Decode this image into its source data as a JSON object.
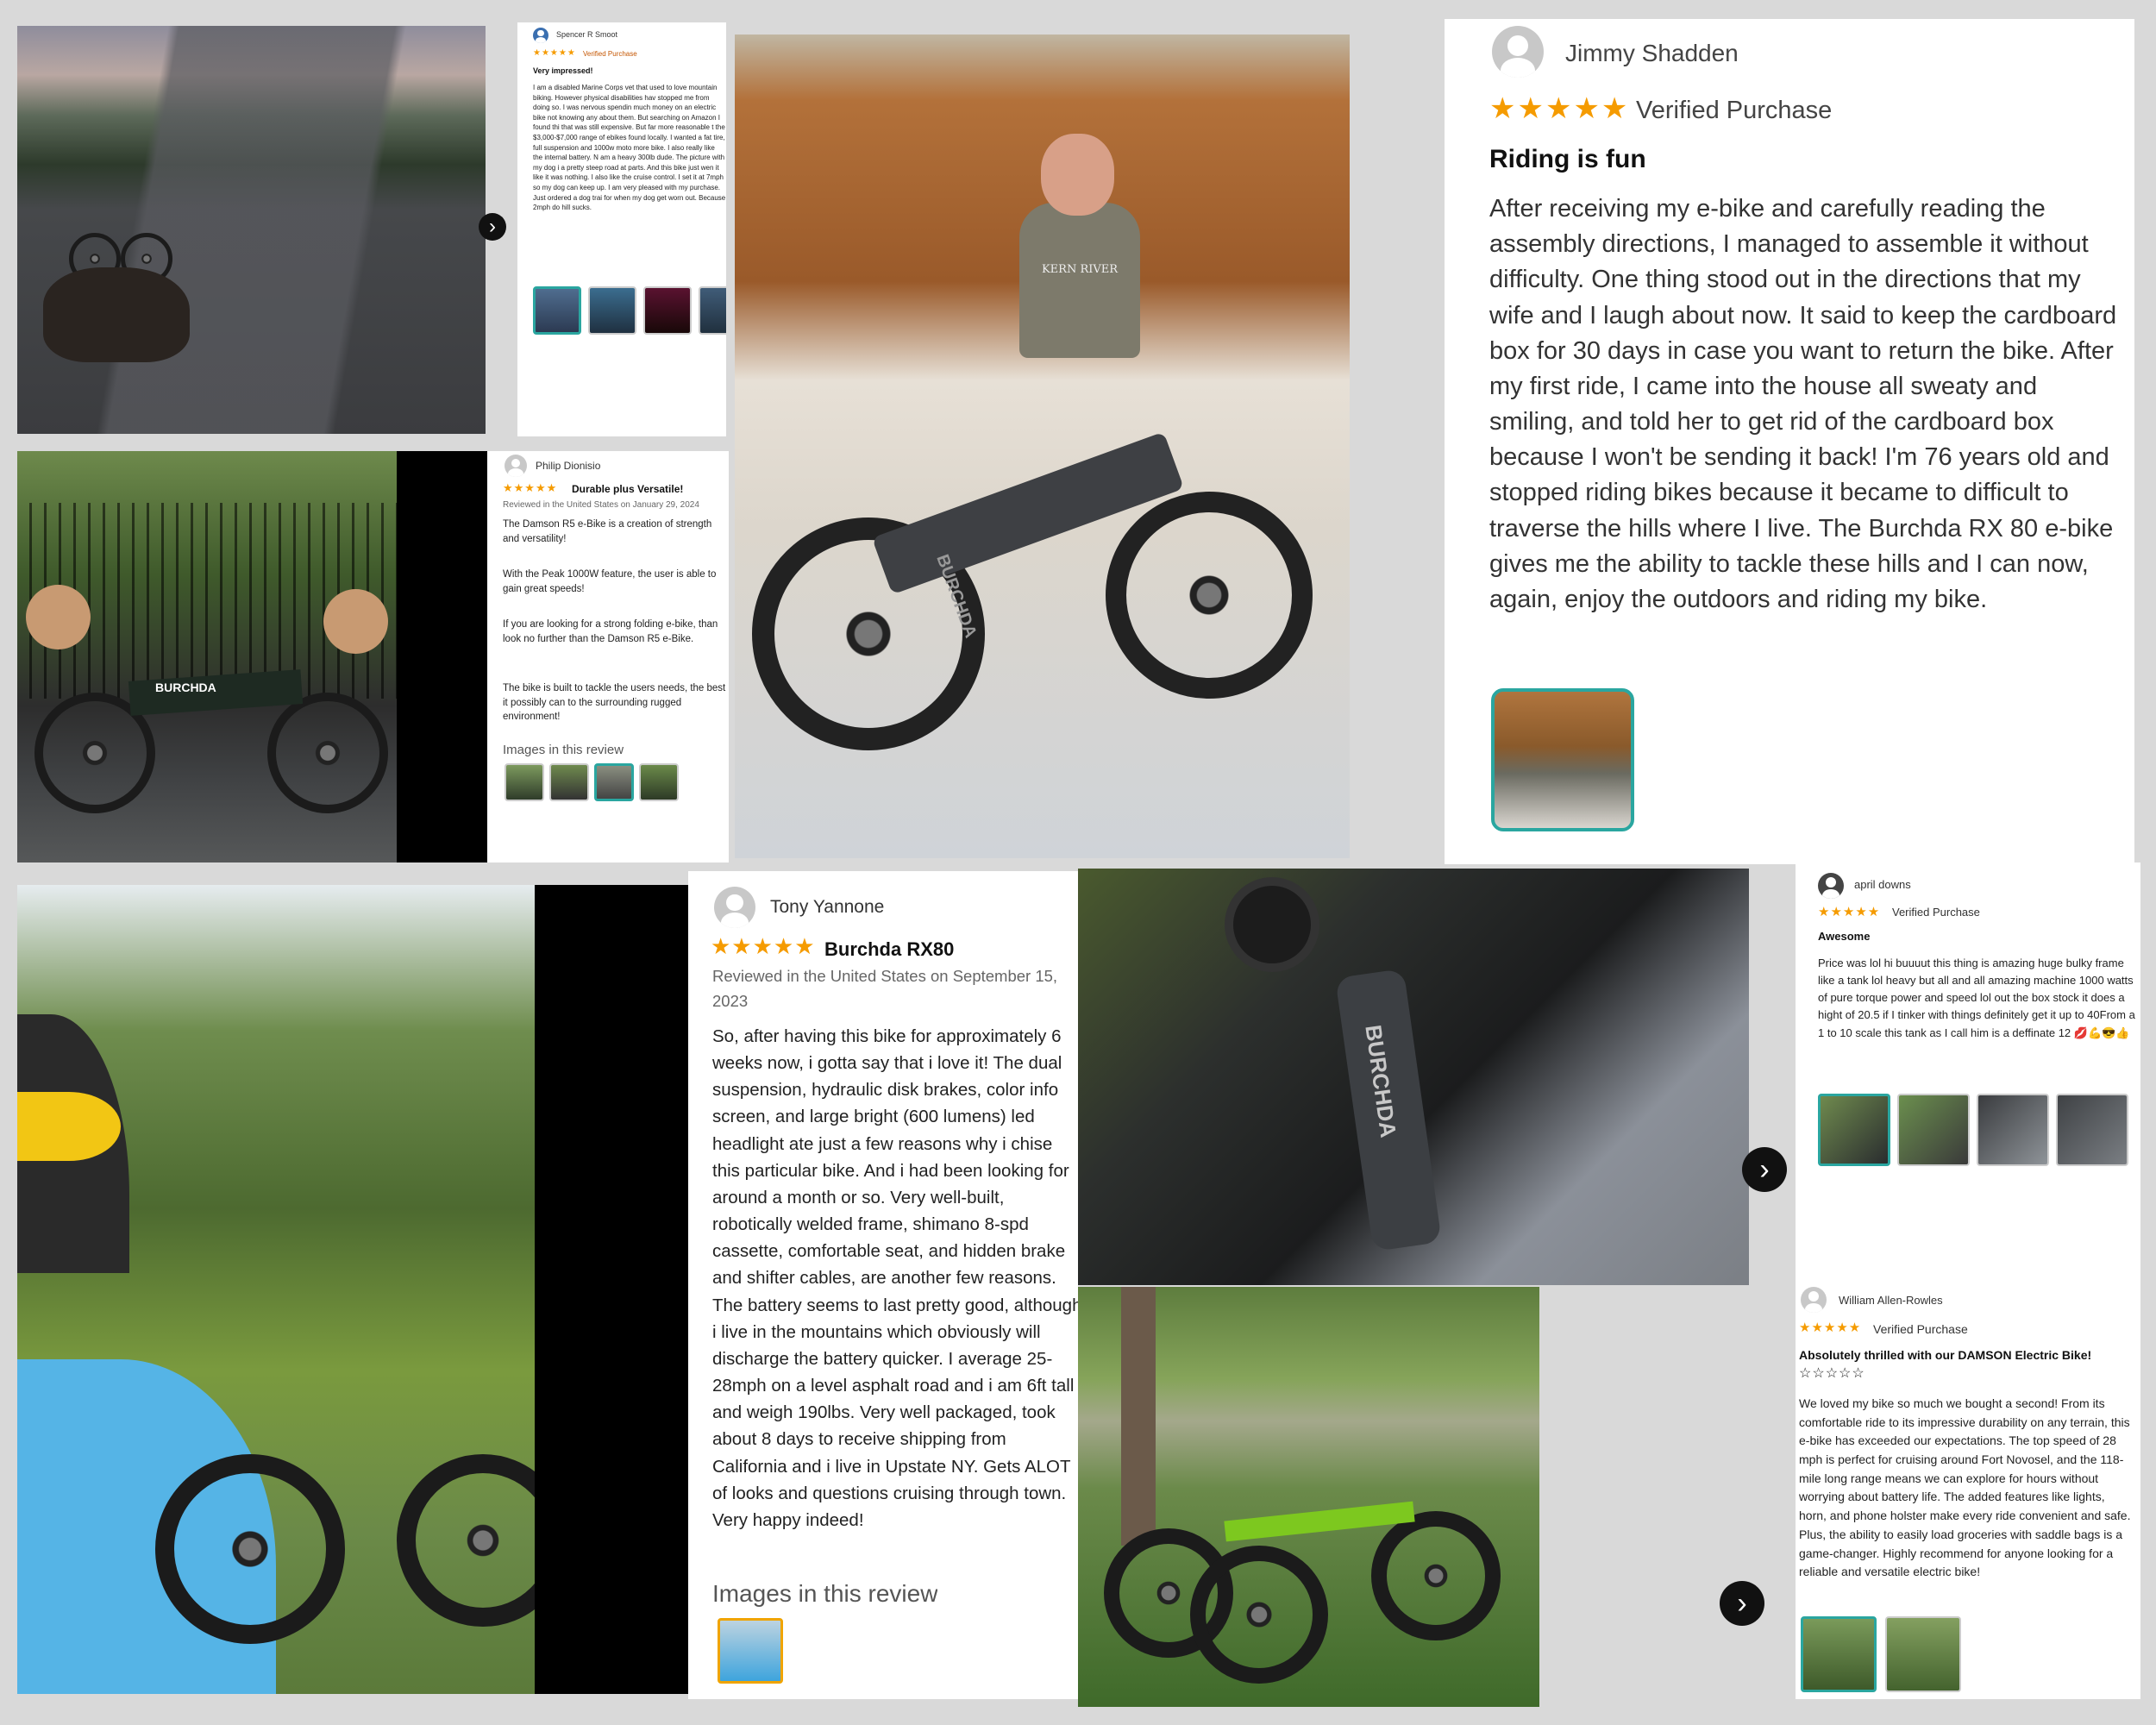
{
  "review1": {
    "reviewer": "Spencer R Smoot",
    "verified": "Verified Purchase",
    "title": "Very impressed!",
    "stars": "★★★★★",
    "body": "I am a disabled Marine Corps vet that used to love mountain biking. However physical disabilities hav stopped me from doing so. I was nervous spendin much money on an electric bike not knowing any about them. But searching on Amazon I found thi that was still expensive. But far more reasonable t the $3,000-$7,000 range of ebikes found locally. I wanted a fat tire, full suspension and 1000w moto more bike. I also really like the internal battery. N am a heavy 300lb dude. The picture with my dog i a pretty steep road at parts. And this bike just wen it like it was nothing. I also like the cruise control. I set it at 7mph so my dog can keep up. I am very pleased with my purchase. Just ordered a dog trai for when my dog get worn out. Because 2mph do hill sucks."
  },
  "review2": {
    "reviewer": "Philip Dionisio",
    "stars": "★★★★★",
    "title": "Durable plus Versatile!",
    "meta": "Reviewed in the United States on January 29, 2024",
    "p1": "The Damson R5 e-Bike is a creation of strength and versatility!",
    "p2": "With the Peak 1000W feature, the user is able to gain great speeds!",
    "p3": "If you are looking for a strong folding e-bike, than look no further than the Damson R5 e-Bike.",
    "p4": "The bike is built to tackle the users needs, the best it possibly can to the surrounding rugged environment!",
    "images_label": "Images in this review",
    "bike_brand": "BURCHDA"
  },
  "review3": {
    "reviewer": "Jimmy Shadden",
    "stars": "★★★★★",
    "verified": "Verified Purchase",
    "title": "Riding is fun",
    "body": "After receiving my e-bike and carefully reading the assembly directions, I managed to assemble it without difficulty. One thing stood out in the directions that my wife and I laugh about now. It said to keep the cardboard box for 30 days in case you want to return the bike. After my first ride, I came into the house all sweaty and smiling, and told her to get rid of the cardboard box because I won't be sending it back! I'm 76 years old and stopped riding bikes because it became to difficult to traverse the hills where I live. The Burchda RX 80 e-bike gives me the ability to tackle these hills and I can now, again, enjoy the outdoors and riding my bike.",
    "shirt_text": "KERN RIVER",
    "bike_brand": "BURCHDA"
  },
  "review4": {
    "reviewer": "Tony Yannone",
    "stars": "★★★★★",
    "title": "Burchda RX80",
    "meta": "Reviewed in the United States on September 15, 2023",
    "body": "So, after having this bike for approximately 6 weeks now, i gotta say that i love it! The dual suspension, hydraulic disk brakes, color info screen, and large bright (600 lumens) led headlight ate just a few reasons why i chise this particular bike. And i had been looking for around a month or so. Very well-built, robotically welded frame, shimano 8-spd cassette, comfortable seat, and hidden brake and shifter cables, are another few reasons. The battery seems to last pretty good, although i live in the mountains which obviously will discharge the battery quicker. I average 25-28mph on a level asphalt road and i am 6ft tall and weigh 190lbs. Very well packaged, took about 8 days to receive shipping from California and i live in Upstate NY. Gets ALOT of looks and questions cruising through town. Very happy indeed!",
    "images_label": "Images in this review"
  },
  "review5": {
    "reviewer": "april downs",
    "stars": "★★★★★",
    "verified": "Verified Purchase",
    "title": "Awesome",
    "body": "Price was lol hi buuuut this thing is amazing huge bulky frame like a tank lol heavy but all and all amazing machine 1000 watts of pure torque power and speed lol out the box stock it does a hight of 20.5 if I tinker with things definitely get it up to 40From a 1 to 10 scale this tank as I call him is a deffinate 12 💋💪😎👍",
    "bike_brand": "BURCHDA"
  },
  "review6": {
    "reviewer": "William Allen-Rowles",
    "stars": "★★★★★",
    "verified": "Verified Purchase",
    "title": "Absolutely thrilled with our DAMSON Electric Bike!",
    "title_stars": "☆☆☆☆☆",
    "body": "We loved my bike so much we bought a second! From its comfortable ride to its impressive durability on any terrain, this e-bike has exceeded our expectations. The top speed of 28 mph is perfect for cruising around Fort Novosel, and the 118-mile long range means we can explore for hours without worrying about battery life. The added features like lights, horn, and phone holster make every ride convenient and safe. Plus, the ability to easily load groceries with saddle bags is a game-changer. Highly recommend for anyone looking for a reliable and versatile electric bike!"
  },
  "icons": {
    "next": "›"
  },
  "colors": {
    "star": "#f59b00",
    "active_thumb": "#2aa6a0",
    "nav_button": "#111111"
  }
}
